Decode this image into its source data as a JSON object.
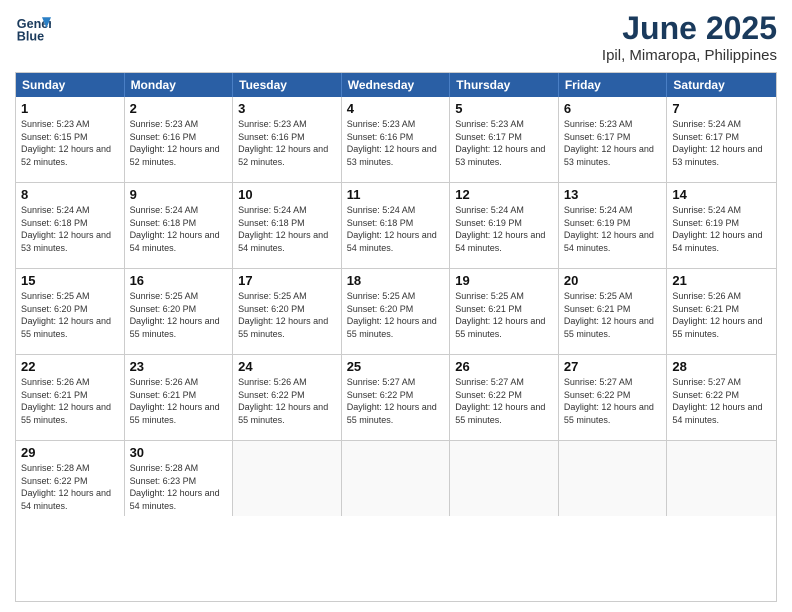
{
  "header": {
    "logo_line1": "General",
    "logo_line2": "Blue",
    "main_title": "June 2025",
    "subtitle": "Ipil, Mimaropa, Philippines"
  },
  "calendar": {
    "days_of_week": [
      "Sunday",
      "Monday",
      "Tuesday",
      "Wednesday",
      "Thursday",
      "Friday",
      "Saturday"
    ],
    "rows": [
      [
        {
          "day": "",
          "empty": true
        },
        {
          "day": "",
          "empty": true
        },
        {
          "day": "",
          "empty": true
        },
        {
          "day": "",
          "empty": true
        },
        {
          "day": "",
          "empty": true
        },
        {
          "day": "",
          "empty": true
        },
        {
          "day": "",
          "empty": true
        }
      ],
      [
        {
          "day": "1",
          "sunrise": "5:23 AM",
          "sunset": "6:15 PM",
          "daylight": "12 hours and 52 minutes."
        },
        {
          "day": "2",
          "sunrise": "5:23 AM",
          "sunset": "6:16 PM",
          "daylight": "12 hours and 52 minutes."
        },
        {
          "day": "3",
          "sunrise": "5:23 AM",
          "sunset": "6:16 PM",
          "daylight": "12 hours and 52 minutes."
        },
        {
          "day": "4",
          "sunrise": "5:23 AM",
          "sunset": "6:16 PM",
          "daylight": "12 hours and 53 minutes."
        },
        {
          "day": "5",
          "sunrise": "5:23 AM",
          "sunset": "6:17 PM",
          "daylight": "12 hours and 53 minutes."
        },
        {
          "day": "6",
          "sunrise": "5:23 AM",
          "sunset": "6:17 PM",
          "daylight": "12 hours and 53 minutes."
        },
        {
          "day": "7",
          "sunrise": "5:24 AM",
          "sunset": "6:17 PM",
          "daylight": "12 hours and 53 minutes."
        }
      ],
      [
        {
          "day": "8",
          "sunrise": "5:24 AM",
          "sunset": "6:18 PM",
          "daylight": "12 hours and 53 minutes."
        },
        {
          "day": "9",
          "sunrise": "5:24 AM",
          "sunset": "6:18 PM",
          "daylight": "12 hours and 54 minutes."
        },
        {
          "day": "10",
          "sunrise": "5:24 AM",
          "sunset": "6:18 PM",
          "daylight": "12 hours and 54 minutes."
        },
        {
          "day": "11",
          "sunrise": "5:24 AM",
          "sunset": "6:18 PM",
          "daylight": "12 hours and 54 minutes."
        },
        {
          "day": "12",
          "sunrise": "5:24 AM",
          "sunset": "6:19 PM",
          "daylight": "12 hours and 54 minutes."
        },
        {
          "day": "13",
          "sunrise": "5:24 AM",
          "sunset": "6:19 PM",
          "daylight": "12 hours and 54 minutes."
        },
        {
          "day": "14",
          "sunrise": "5:24 AM",
          "sunset": "6:19 PM",
          "daylight": "12 hours and 54 minutes."
        }
      ],
      [
        {
          "day": "15",
          "sunrise": "5:25 AM",
          "sunset": "6:20 PM",
          "daylight": "12 hours and 55 minutes."
        },
        {
          "day": "16",
          "sunrise": "5:25 AM",
          "sunset": "6:20 PM",
          "daylight": "12 hours and 55 minutes."
        },
        {
          "day": "17",
          "sunrise": "5:25 AM",
          "sunset": "6:20 PM",
          "daylight": "12 hours and 55 minutes."
        },
        {
          "day": "18",
          "sunrise": "5:25 AM",
          "sunset": "6:20 PM",
          "daylight": "12 hours and 55 minutes."
        },
        {
          "day": "19",
          "sunrise": "5:25 AM",
          "sunset": "6:21 PM",
          "daylight": "12 hours and 55 minutes."
        },
        {
          "day": "20",
          "sunrise": "5:25 AM",
          "sunset": "6:21 PM",
          "daylight": "12 hours and 55 minutes."
        },
        {
          "day": "21",
          "sunrise": "5:26 AM",
          "sunset": "6:21 PM",
          "daylight": "12 hours and 55 minutes."
        }
      ],
      [
        {
          "day": "22",
          "sunrise": "5:26 AM",
          "sunset": "6:21 PM",
          "daylight": "12 hours and 55 minutes."
        },
        {
          "day": "23",
          "sunrise": "5:26 AM",
          "sunset": "6:21 PM",
          "daylight": "12 hours and 55 minutes."
        },
        {
          "day": "24",
          "sunrise": "5:26 AM",
          "sunset": "6:22 PM",
          "daylight": "12 hours and 55 minutes."
        },
        {
          "day": "25",
          "sunrise": "5:27 AM",
          "sunset": "6:22 PM",
          "daylight": "12 hours and 55 minutes."
        },
        {
          "day": "26",
          "sunrise": "5:27 AM",
          "sunset": "6:22 PM",
          "daylight": "12 hours and 55 minutes."
        },
        {
          "day": "27",
          "sunrise": "5:27 AM",
          "sunset": "6:22 PM",
          "daylight": "12 hours and 55 minutes."
        },
        {
          "day": "28",
          "sunrise": "5:27 AM",
          "sunset": "6:22 PM",
          "daylight": "12 hours and 54 minutes."
        }
      ],
      [
        {
          "day": "29",
          "sunrise": "5:28 AM",
          "sunset": "6:22 PM",
          "daylight": "12 hours and 54 minutes."
        },
        {
          "day": "30",
          "sunrise": "5:28 AM",
          "sunset": "6:23 PM",
          "daylight": "12 hours and 54 minutes."
        },
        {
          "day": "",
          "empty": true
        },
        {
          "day": "",
          "empty": true
        },
        {
          "day": "",
          "empty": true
        },
        {
          "day": "",
          "empty": true
        },
        {
          "day": "",
          "empty": true
        }
      ]
    ]
  }
}
